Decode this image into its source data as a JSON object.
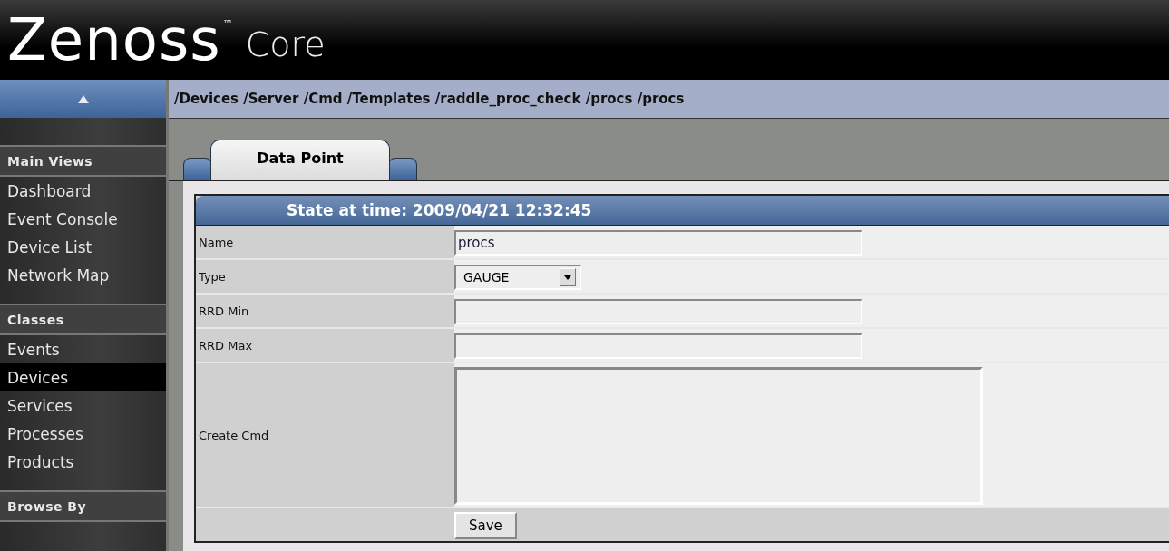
{
  "logo": {
    "name": "Zenoss",
    "trademark": "™",
    "product": "Core"
  },
  "breadcrumb": "/Devices /Server /Cmd /Templates /raddle_proc_check /procs /procs",
  "sidebar": {
    "sections": [
      {
        "title": "Main Views",
        "items": [
          {
            "label": "Dashboard",
            "selected": false
          },
          {
            "label": "Event Console",
            "selected": false
          },
          {
            "label": "Device List",
            "selected": false
          },
          {
            "label": "Network Map",
            "selected": false
          }
        ]
      },
      {
        "title": "Classes",
        "items": [
          {
            "label": "Events",
            "selected": false
          },
          {
            "label": "Devices",
            "selected": true
          },
          {
            "label": "Services",
            "selected": false
          },
          {
            "label": "Processes",
            "selected": false
          },
          {
            "label": "Products",
            "selected": false
          }
        ]
      },
      {
        "title": "Browse By"
      }
    ]
  },
  "tabs": [
    {
      "label": "Data Point",
      "selected": true
    }
  ],
  "form": {
    "header": "State at time: 2009/04/21 12:32:45",
    "fields": [
      {
        "kind": "text",
        "label": "Name",
        "value": "procs"
      },
      {
        "kind": "select",
        "label": "Type",
        "value": "GAUGE"
      },
      {
        "kind": "text",
        "label": "RRD Min"
      },
      {
        "kind": "text",
        "label": "RRD Max"
      },
      {
        "kind": "textarea",
        "label": "Create Cmd"
      }
    ],
    "save_button": "Save"
  }
}
